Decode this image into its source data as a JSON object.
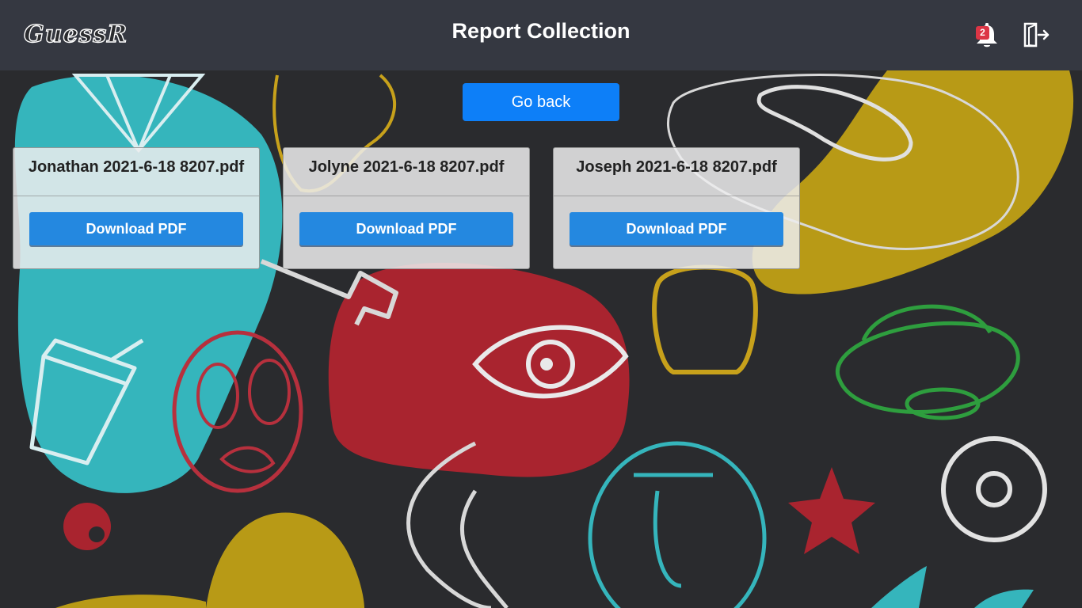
{
  "header": {
    "logo_text": "GuessR",
    "title": "Report Collection",
    "notification_count": "2",
    "bell_icon": "bell-icon",
    "logout_icon": "sign-out-icon"
  },
  "actions": {
    "go_back_label": "Go back"
  },
  "reports": [
    {
      "filename": "Jonathan 2021-6-18 8207.pdf",
      "button_label": "Download PDF"
    },
    {
      "filename": "Jolyne 2021-6-18 8207.pdf",
      "button_label": "Download PDF"
    },
    {
      "filename": "Joseph 2021-6-18 8207.pdf",
      "button_label": "Download PDF"
    }
  ],
  "colors": {
    "header_bg": "#353841",
    "page_bg": "#2a2b2e",
    "primary_button": "#0d7ff8",
    "download_button": "#2488e0",
    "badge": "#dc3545",
    "doodle_teal": "#35b5bc",
    "doodle_red": "#a9242f",
    "doodle_yellow": "#b89a16",
    "doodle_green": "#2e9e3e"
  }
}
